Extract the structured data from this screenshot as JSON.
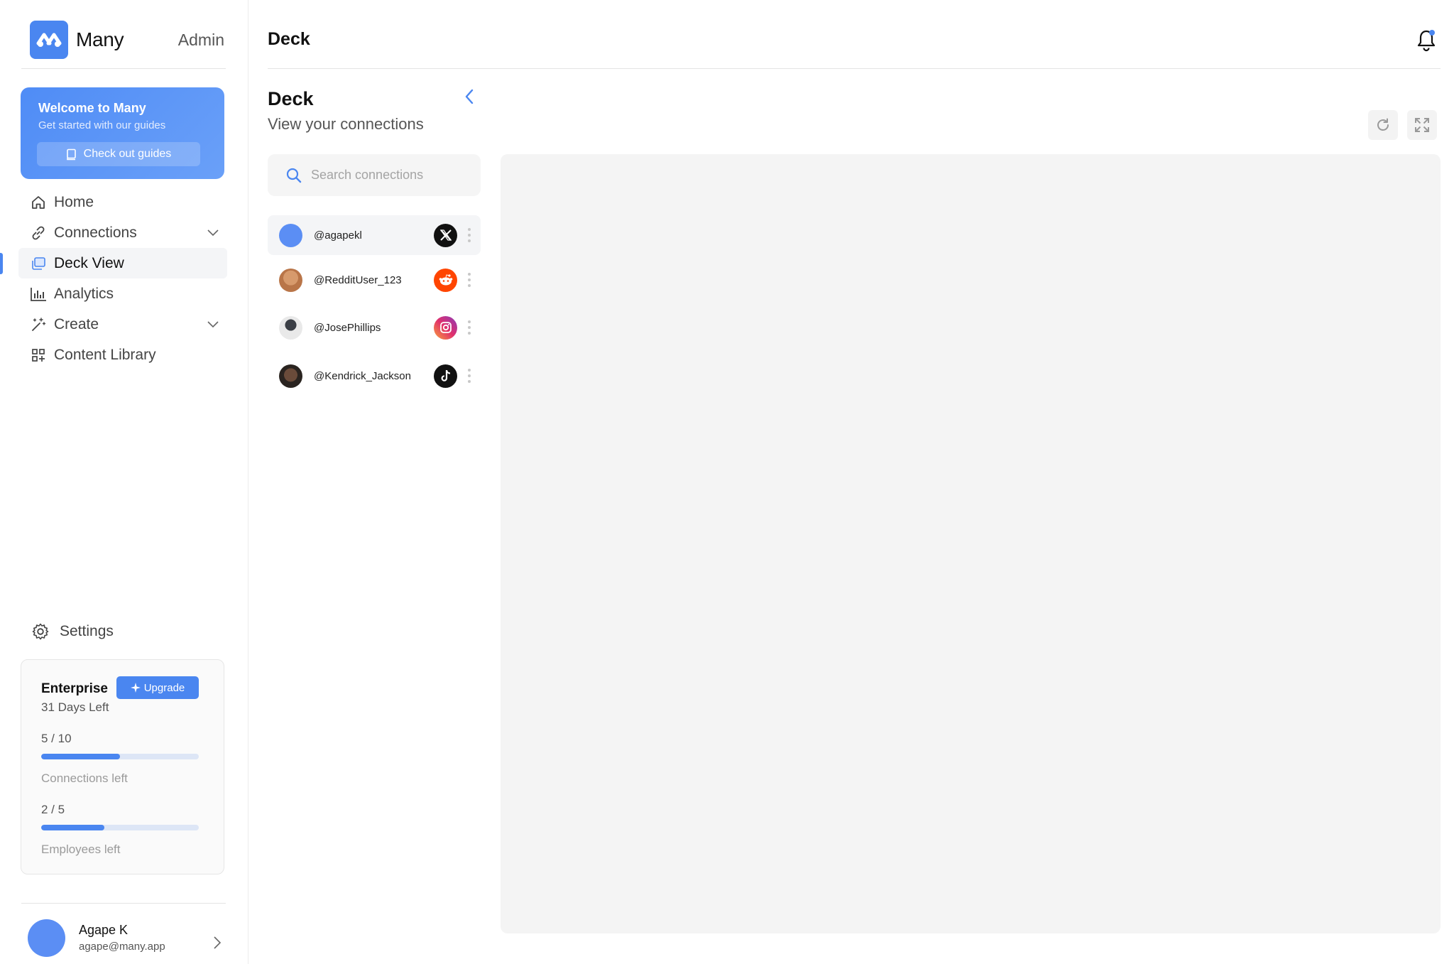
{
  "app": {
    "brand_name": "Many",
    "role": "Admin",
    "accent_color": "#4a86f0"
  },
  "welcome": {
    "title": "Welcome to Many",
    "subtitle": "Get started with our guides",
    "button_label": "Check out guides"
  },
  "nav": {
    "items": [
      {
        "label": "Home",
        "icon": "home-icon"
      },
      {
        "label": "Connections",
        "icon": "link-icon",
        "expandable": true
      },
      {
        "label": "Deck View",
        "icon": "deck-icon",
        "active": true
      },
      {
        "label": "Analytics",
        "icon": "bar-chart-icon"
      },
      {
        "label": "Create",
        "icon": "magic-wand-icon",
        "expandable": true
      },
      {
        "label": "Content Library",
        "icon": "grid-icon"
      }
    ],
    "settings_label": "Settings"
  },
  "plan": {
    "name": "Enterprise",
    "upgrade_label": "Upgrade",
    "days_left": "31 Days Left",
    "connections": {
      "used": 5,
      "total": 10,
      "count_text": "5 / 10",
      "label": "Connections left"
    },
    "employees": {
      "used": 2,
      "total": 5,
      "count_text": "2 / 5",
      "label": "Employees left"
    }
  },
  "user": {
    "name": "Agape K",
    "email": "agape@many.app"
  },
  "header": {
    "title": "Deck"
  },
  "deck": {
    "title": "Deck",
    "subtitle": "View your connections",
    "search_placeholder": "Search connections",
    "connections": [
      {
        "handle": "@agapekl",
        "platform": "x",
        "avatar_color": "#5b8ef4",
        "selected": true
      },
      {
        "handle": "@RedditUser_123",
        "platform": "reddit",
        "avatar_color": "#c98a5e"
      },
      {
        "handle": "@JosePhillips",
        "platform": "instagram",
        "avatar_color": "#555b66"
      },
      {
        "handle": "@Kendrick_Jackson",
        "platform": "tiktok",
        "avatar_color": "#4a3b33"
      }
    ]
  }
}
